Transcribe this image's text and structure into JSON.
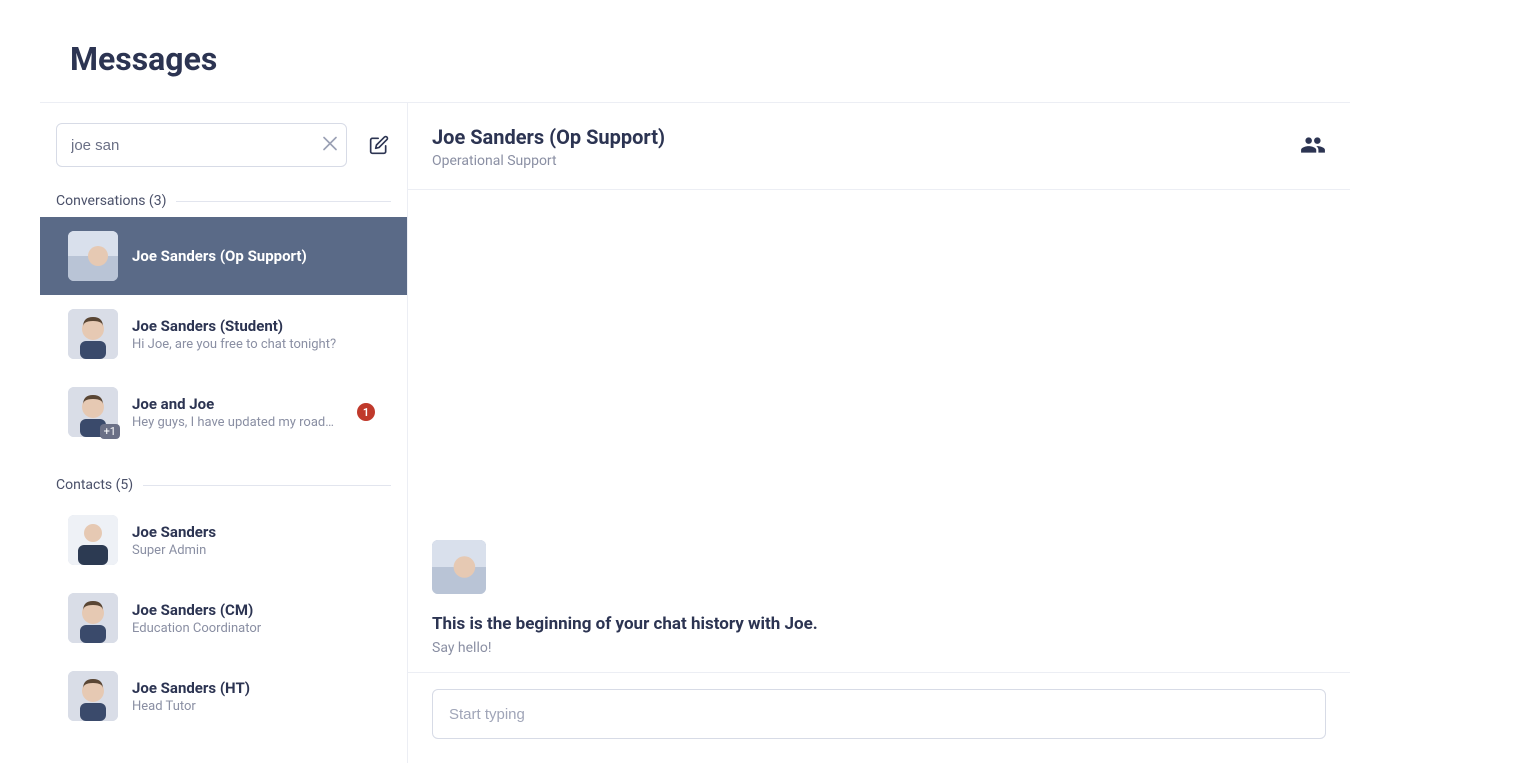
{
  "page": {
    "title": "Messages"
  },
  "search": {
    "value": "joe san",
    "clear_icon": "close-icon"
  },
  "compose": {
    "icon": "compose-icon"
  },
  "sections": {
    "conversations_label": "Conversations (3)",
    "contacts_label": "Contacts (5)"
  },
  "conversations": [
    {
      "name": "Joe Sanders (Op Support)",
      "preview": "",
      "selected": true,
      "avatar_style": "rotated"
    },
    {
      "name": "Joe Sanders (Student)",
      "preview": "Hi Joe, are you free to chat tonight?",
      "avatar_style": "normal"
    },
    {
      "name": "Joe and Joe",
      "preview": "Hey guys, I have updated my roadm…",
      "badge": "1",
      "overflow_badge": "+1",
      "avatar_style": "normal"
    }
  ],
  "contacts": [
    {
      "name": "Joe Sanders",
      "role": "Super Admin",
      "avatar_style": "bust"
    },
    {
      "name": "Joe Sanders (CM)",
      "role": "Education Coordinator",
      "avatar_style": "normal"
    },
    {
      "name": "Joe Sanders (HT)",
      "role": "Head Tutor",
      "avatar_style": "normal"
    }
  ],
  "chat": {
    "title": "Joe Sanders (Op Support)",
    "subtitle": "Operational Support",
    "group_icon": "people-icon",
    "empty_title": "This is the beginning of your chat history with Joe.",
    "empty_sub": "Say hello!",
    "input_placeholder": "Start typing"
  }
}
